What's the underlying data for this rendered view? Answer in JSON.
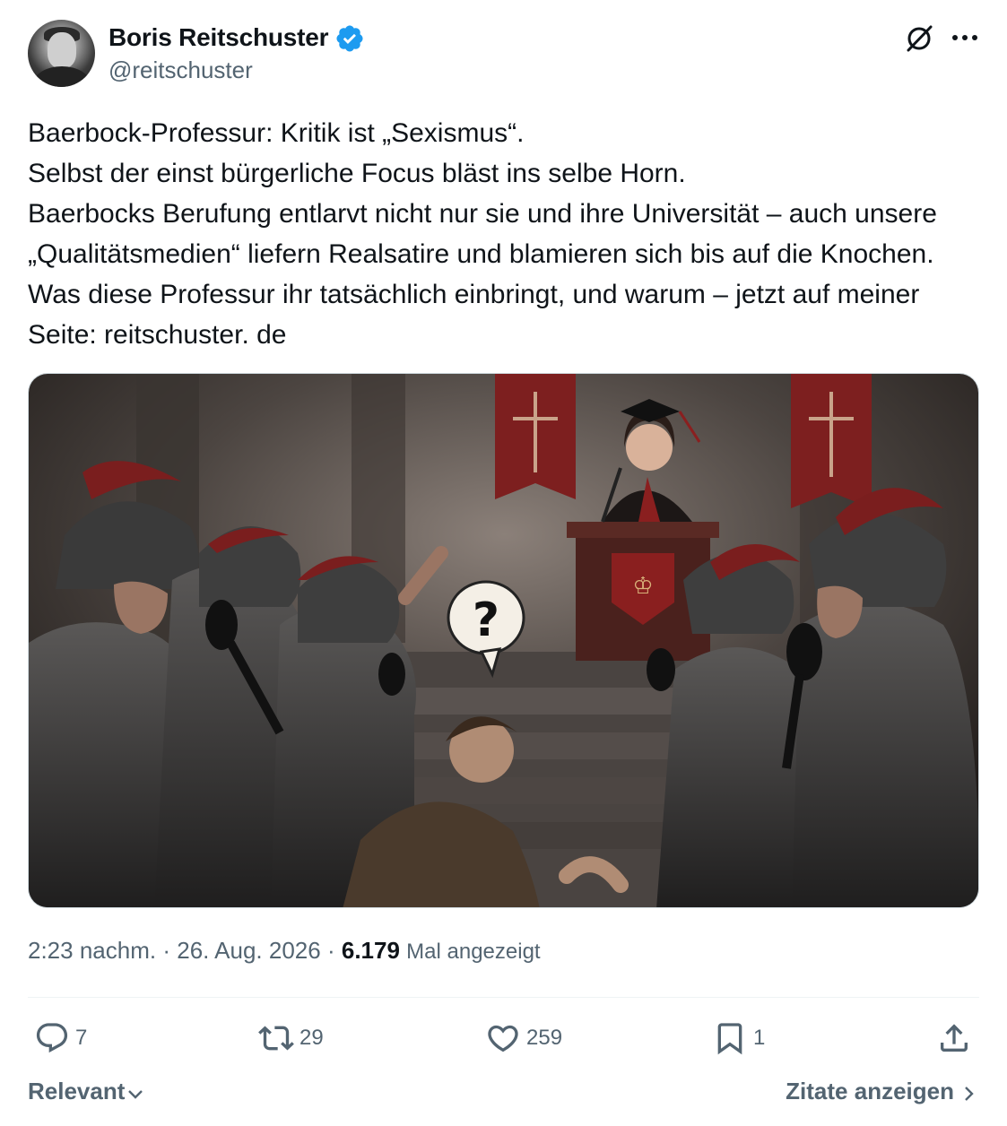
{
  "author": {
    "name": "Boris Reitschuster",
    "handle": "@reitschuster",
    "verified": true
  },
  "tweet": {
    "text": "Baerbock-Professur: Kritik ist „Sexismus“.\nSelbst der einst bürgerliche Focus bläst ins selbe Horn.\nBaerbocks Berufung entlarvt nicht nur sie und ihre Universität – auch unsere „Qualitätsmedien“ liefern Realsatire und blamieren sich bis auf die Knochen. Was diese Professur ihr tatsächlich einbringt, und warum – jetzt auf meiner Seite: reitschuster. de"
  },
  "meta": {
    "time": "2:23 nachm.",
    "separator": "·",
    "date": "26. Aug. 2026",
    "views": "6.179",
    "views_label": "Mal angezeigt"
  },
  "actions": {
    "replies": "7",
    "retweets": "29",
    "likes": "259",
    "bookmarks": "1"
  },
  "footer": {
    "sort_label": "Relevant",
    "quotes_label": "Zitate anzeigen"
  },
  "image": {
    "bubble_text": "?"
  },
  "colors": {
    "accent": "#1d9bf0",
    "secondary_text": "#536471",
    "primary_text": "#0f1419",
    "banner_red": "#8a1f1f"
  }
}
